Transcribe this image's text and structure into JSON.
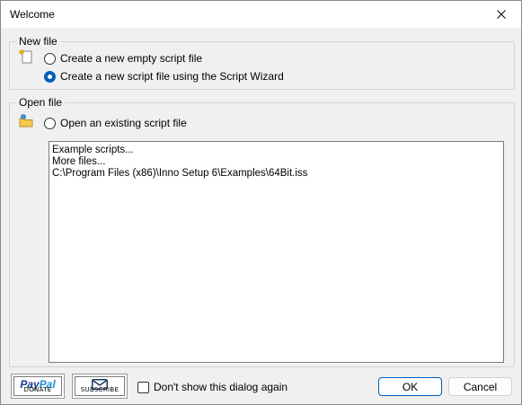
{
  "window": {
    "title": "Welcome"
  },
  "new_file": {
    "legend": "New file",
    "options": [
      {
        "label": "Create a new empty script file",
        "checked": false
      },
      {
        "label": "Create a new script file using the Script Wizard",
        "checked": true
      }
    ]
  },
  "open_file": {
    "legend": "Open file",
    "option_label": "Open an existing script file",
    "option_checked": false,
    "files": [
      "Example scripts...",
      "More files...",
      "C:\\Program Files (x86)\\Inno Setup 6\\Examples\\64Bit.iss"
    ]
  },
  "footer": {
    "paypal_logo_pay": "Pay",
    "paypal_logo_pal": "Pal",
    "paypal_caption": "DONATE",
    "subscribe_caption": "SUBSCRIBE",
    "dont_show_label": "Don't show this dialog again",
    "dont_show_checked": false,
    "ok_label": "OK",
    "cancel_label": "Cancel"
  },
  "colors": {
    "accent": "#005fb8",
    "paypal_dark": "#1a3a8f",
    "paypal_light": "#1e8fd6",
    "icon_yellow": "#f2c94c"
  }
}
